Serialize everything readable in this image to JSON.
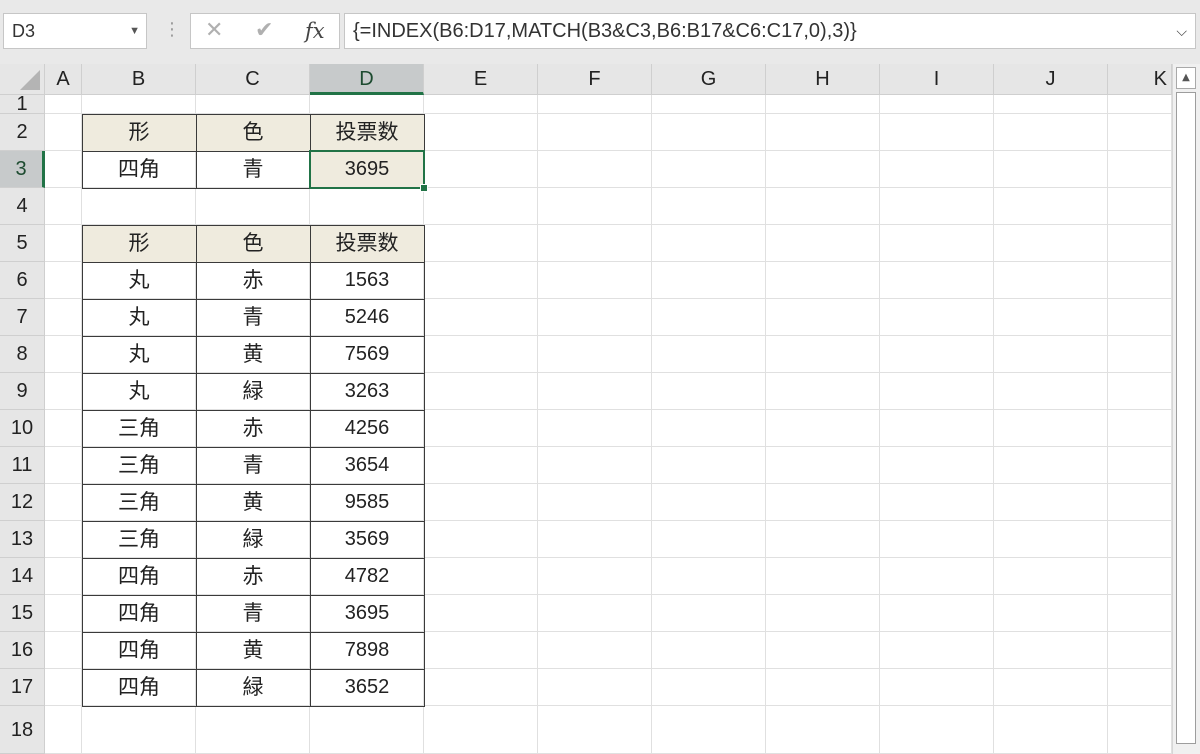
{
  "formula_bar": {
    "name_box": "D3",
    "name_box_dropdown_icon": "caret-down-icon",
    "separator": "⋮",
    "cancel_icon": "✕",
    "enter_icon": "✔",
    "fx_label": "fx",
    "formula": "{=INDEX(B6:D17,MATCH(B3&C3,B6:B17&C6:C17,0),3)}",
    "expand_icon": "chevron-down-icon"
  },
  "columns": [
    "A",
    "B",
    "C",
    "D",
    "E",
    "F",
    "G",
    "H",
    "I",
    "J",
    "K"
  ],
  "rows": [
    "1",
    "2",
    "3",
    "4",
    "5",
    "6",
    "7",
    "8",
    "9",
    "10",
    "11",
    "12",
    "13",
    "14",
    "15",
    "16",
    "17",
    "18"
  ],
  "active_cell": "D3",
  "colors": {
    "accent": "#217346",
    "table_header_fill": "#efebde",
    "header_bg": "#e6e6e6",
    "gridline": "#e0e0e0"
  },
  "lookup": {
    "headers": [
      "形",
      "色",
      "投票数"
    ],
    "shape": "四角",
    "color": "青",
    "result": "3695"
  },
  "table": {
    "headers": [
      "形",
      "色",
      "投票数"
    ],
    "rows": [
      [
        "丸",
        "赤",
        "1563"
      ],
      [
        "丸",
        "青",
        "5246"
      ],
      [
        "丸",
        "黄",
        "7569"
      ],
      [
        "丸",
        "緑",
        "3263"
      ],
      [
        "三角",
        "赤",
        "4256"
      ],
      [
        "三角",
        "青",
        "3654"
      ],
      [
        "三角",
        "黄",
        "9585"
      ],
      [
        "三角",
        "緑",
        "3569"
      ],
      [
        "四角",
        "赤",
        "4782"
      ],
      [
        "四角",
        "青",
        "3695"
      ],
      [
        "四角",
        "黄",
        "7898"
      ],
      [
        "四角",
        "緑",
        "3652"
      ]
    ]
  }
}
